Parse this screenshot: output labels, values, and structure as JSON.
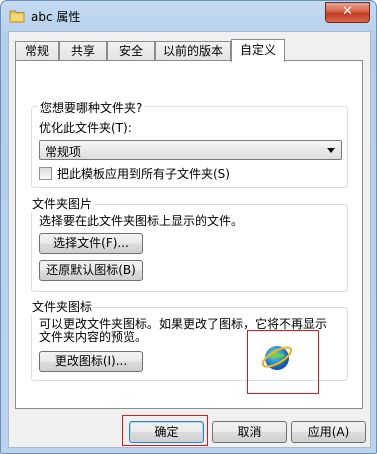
{
  "window": {
    "title": "abc 属性",
    "close_label": "✕"
  },
  "tabs": [
    "常规",
    "共享",
    "安全",
    "以前的版本",
    "自定义"
  ],
  "active_tab": "自定义",
  "folder_type_section": {
    "heading": "您想要哪种文件夹?",
    "optimize_label": "优化此文件夹(T):",
    "combo_value": "常规项",
    "apply_checkbox_label": "把此模板应用到所有子文件夹(S)",
    "apply_checked": false
  },
  "folder_picture_section": {
    "title": "文件夹图片",
    "description": "选择要在此文件夹图标上显示的文件。",
    "choose_file_button": "选择文件(F)...",
    "restore_default_button": "还原默认图标(B)"
  },
  "folder_icon_section": {
    "title": "文件夹图标",
    "description_line1": "可以更改文件夹图标。如果更改了图标，它将不再显示",
    "description_line2": "文件夹内容的预览。",
    "change_icon_button": "更改图标(I)..."
  },
  "footer": {
    "ok": "确定",
    "cancel": "取消",
    "apply": "应用(A)"
  },
  "colors": {
    "highlight_box": "#e5141b",
    "window_frame": "#b9d1ec"
  }
}
